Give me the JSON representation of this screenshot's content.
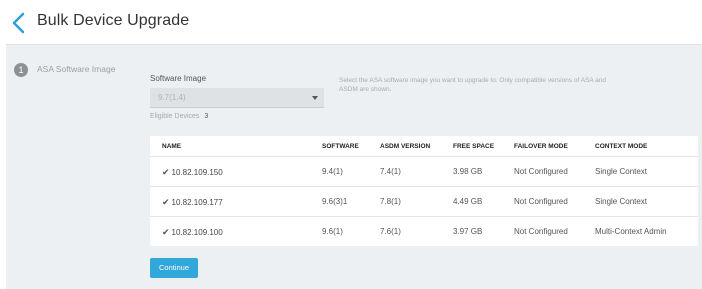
{
  "header": {
    "title": "Bulk Device Upgrade"
  },
  "step": {
    "number": "1",
    "label": "ASA Software Image"
  },
  "software_image": {
    "label": "Software Image",
    "selected": "9.7(1.4)",
    "help": "Select the ASA software image you want to upgrade to. Only compatible versions of ASA and ASDM are shown.",
    "eligible_label": "Eligible Devices",
    "eligible_count": "3"
  },
  "table": {
    "headers": [
      "NAME",
      "SOFTWARE",
      "ASDM VERSION",
      "FREE SPACE",
      "FAILOVER MODE",
      "CONTEXT MODE"
    ],
    "rows": [
      {
        "check": "✔",
        "name": "10.82.109.150",
        "software": "9.4(1)",
        "asdm": "7.4(1)",
        "free": "3.98 GB",
        "failover": "Not Configured",
        "context": "Single Context"
      },
      {
        "check": "✔",
        "name": "10.82.109.177",
        "software": "9.6(3)1",
        "asdm": "7.8(1)",
        "free": "4.49 GB",
        "failover": "Not Configured",
        "context": "Single Context"
      },
      {
        "check": "✔",
        "name": "10.82.109.100",
        "software": "9.6(1)",
        "asdm": "7.6(1)",
        "free": "3.97 GB",
        "failover": "Not Configured",
        "context": "Multi-Context Admin"
      }
    ]
  },
  "actions": {
    "continue_label": "Continue"
  },
  "colors": {
    "accent": "#31a8d9",
    "panel": "#edf0f3",
    "back_arrow": "#2b9fd9"
  }
}
